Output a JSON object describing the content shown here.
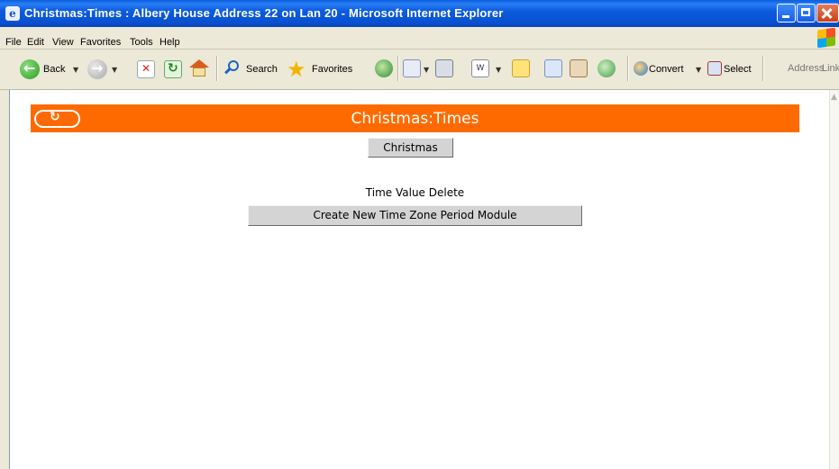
{
  "window": {
    "title": "Christmas:Times : Albery House Address 22 on Lan 20 - Microsoft Internet Explorer"
  },
  "menu": [
    "File",
    "Edit",
    "View",
    "Favorites",
    "Tools",
    "Help"
  ],
  "toolbar": {
    "back_label": "Back",
    "search_label": "Search",
    "favorites_label": "Favorites",
    "convert_label": "Convert",
    "select_label": "Select",
    "address_label": "Address",
    "links_label": "Link"
  },
  "page": {
    "header_title": "Christmas:Times",
    "christmas_button": "Christmas",
    "column_labels": "Time Value Delete",
    "create_button": "Create New Time Zone Period Module",
    "accent_color": "#ff6a00"
  }
}
